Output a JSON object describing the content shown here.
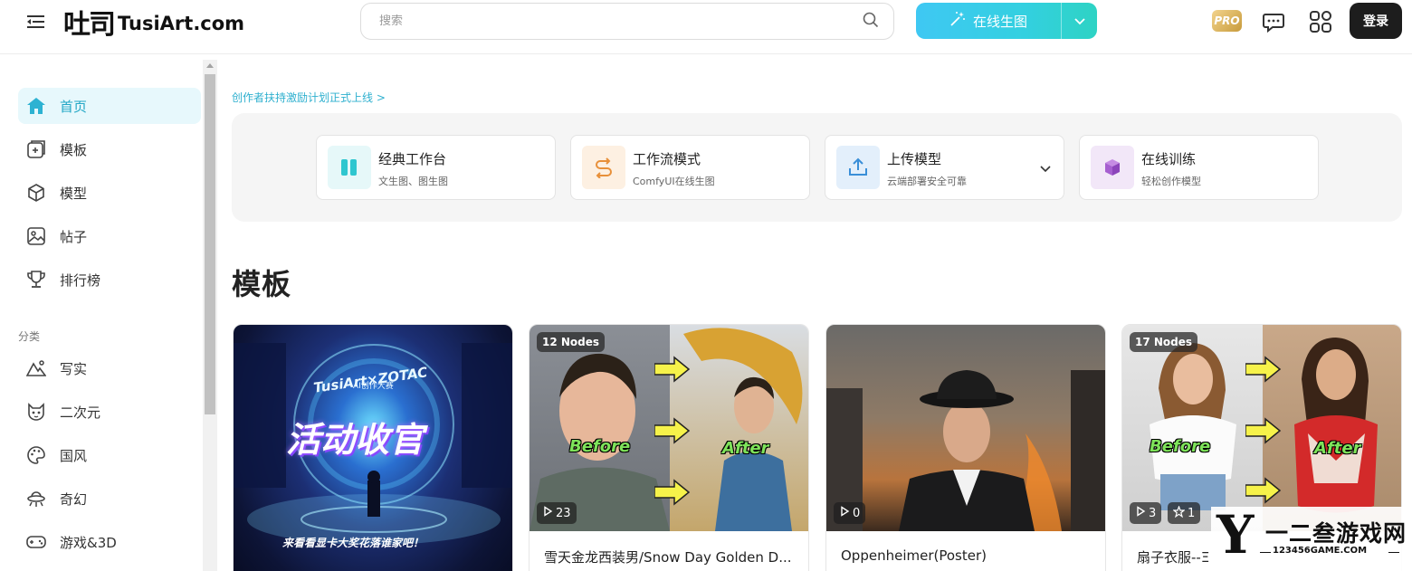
{
  "header": {
    "logo_cn": "吐司",
    "logo_en": "TusiArt.com",
    "search_placeholder": "搜索",
    "generate_label": "在线生图",
    "pro_label": "PRO",
    "login_label": "登录"
  },
  "sidebar": {
    "items": [
      {
        "label": "首页",
        "icon": "home-icon"
      },
      {
        "label": "模板",
        "icon": "template-icon"
      },
      {
        "label": "模型",
        "icon": "cube-icon"
      },
      {
        "label": "帖子",
        "icon": "image-icon"
      },
      {
        "label": "排行榜",
        "icon": "trophy-icon"
      }
    ],
    "section_label": "分类",
    "categories": [
      {
        "label": "写实",
        "icon": "mountain-icon"
      },
      {
        "label": "二次元",
        "icon": "cat-face-icon"
      },
      {
        "label": "国风",
        "icon": "palette-icon"
      },
      {
        "label": "奇幻",
        "icon": "ufo-icon"
      },
      {
        "label": "游戏&3D",
        "icon": "gamepad-icon"
      }
    ]
  },
  "main": {
    "notice": "创作者扶持激励计划正式上线 >",
    "quick_actions": [
      {
        "title": "经典工作台",
        "subtitle": "文生图、图生图",
        "icon": "columns-icon",
        "color": "#2fc6cf",
        "bg": "#e6f8f9"
      },
      {
        "title": "工作流模式",
        "subtitle": "ComfyUI在线生图",
        "icon": "workflow-icon",
        "color": "#e8903a",
        "bg": "#fdf0e2"
      },
      {
        "title": "上传模型",
        "subtitle": "云端部署安全可靠",
        "icon": "upload-icon",
        "color": "#3a8fd8",
        "bg": "#e3effb"
      },
      {
        "title": "在线训练",
        "subtitle": "轻松创作模型",
        "icon": "box-icon",
        "color": "#a65fd0",
        "bg": "#f2e7f8"
      }
    ],
    "section_title": "模板",
    "cards": [
      {
        "title": "",
        "nodes": "",
        "runs": "",
        "stars": "",
        "poster_top": "TusiArt×ZOTAC",
        "poster_sub": "AI创作大赛",
        "poster_main": "活动收官",
        "poster_bottom": "来看看显卡大奖花落谁家吧！"
      },
      {
        "title": "雪天金龙西装男/Snow Day Golden D...",
        "nodes": "12 Nodes",
        "runs": "23",
        "stars": "",
        "before": "Before",
        "after": "After"
      },
      {
        "title": "Oppenheimer(Poster)",
        "nodes": "",
        "runs": "0",
        "stars": ""
      },
      {
        "title": "扇子衣服--Ξ",
        "nodes": "17 Nodes",
        "runs": "3",
        "stars": "1",
        "before": "Before",
        "after": "After"
      }
    ]
  },
  "watermark": {
    "big": "Y",
    "cn": "一二叁游戏网",
    "en": "123456GAME.COM"
  }
}
